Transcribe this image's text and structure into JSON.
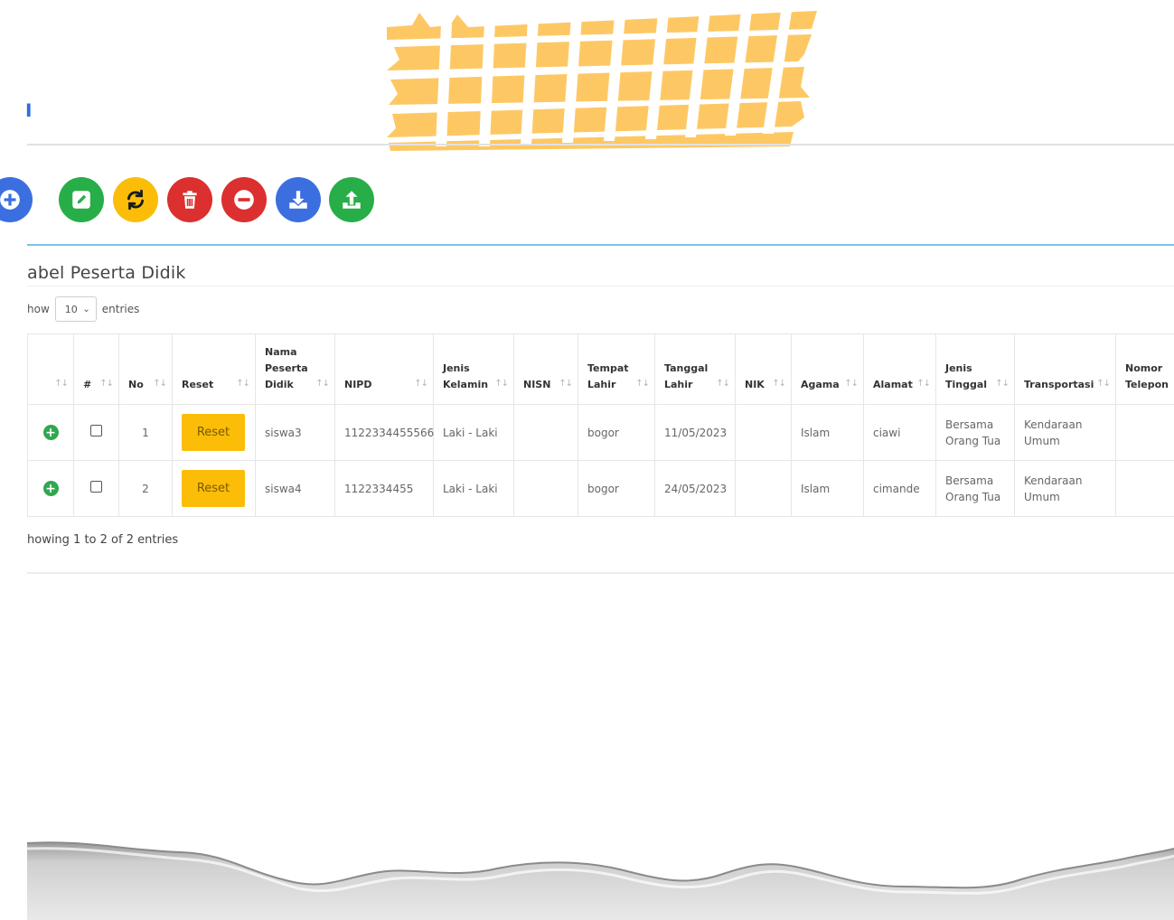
{
  "colors": {
    "tape": "#fdc864",
    "blue": "#3b82f6",
    "green": "#27ae48",
    "yellow": "#fbbd08",
    "red": "#dc2f2f",
    "reset_button": "#fbbd08",
    "divider_blue": "#7cc4e6"
  },
  "brand_glyph": "ⵏ",
  "toolbar": {
    "buttons": [
      {
        "name": "add-button",
        "icon": "plus-circle-icon",
        "color": "#3b6fe0"
      },
      {
        "name": "edit-button",
        "icon": "edit-icon",
        "color": "#27ae48"
      },
      {
        "name": "refresh-button",
        "icon": "refresh-icon",
        "color": "#fbbd08"
      },
      {
        "name": "delete-button",
        "icon": "trash-icon",
        "color": "#dc2f2f"
      },
      {
        "name": "remove-button",
        "icon": "minus-circle-icon",
        "color": "#dc2f2f"
      },
      {
        "name": "download-button",
        "icon": "download-icon",
        "color": "#3b6fe0"
      },
      {
        "name": "upload-button",
        "icon": "upload-icon",
        "color": "#27ae48"
      }
    ]
  },
  "table": {
    "title": "abel Peserta Didik",
    "length_label_before": "how",
    "length_value": "10",
    "length_label_after": "entries",
    "info": "howing 1 to 2 of 2 entries",
    "columns": [
      {
        "label": "",
        "sort": "↑↓"
      },
      {
        "label": "#",
        "sort": "↑↓"
      },
      {
        "label": "No",
        "sort": "↑↓"
      },
      {
        "label": "Reset",
        "sort": "↑↓"
      },
      {
        "label": "Nama Peserta Didik",
        "sort": "↑↓"
      },
      {
        "label": "NIPD",
        "sort": "↑↓"
      },
      {
        "label": "Jenis Kelamin",
        "sort": "↑↓"
      },
      {
        "label": "NISN",
        "sort": "↑↓"
      },
      {
        "label": "Tempat Lahir",
        "sort": "↑↓"
      },
      {
        "label": "Tanggal Lahir",
        "sort": "↑↓"
      },
      {
        "label": "NIK",
        "sort": "↑↓"
      },
      {
        "label": "Agama",
        "sort": "↑↓"
      },
      {
        "label": "Alamat",
        "sort": "↑↓"
      },
      {
        "label": "Jenis Tinggal",
        "sort": "↑↓"
      },
      {
        "label": "Transportasi",
        "sort": "↑↓"
      },
      {
        "label": "Nomor Telepon",
        "sort": ""
      }
    ],
    "rows": [
      {
        "expand": "+",
        "no": "1",
        "reset": "Reset",
        "nama": "siswa3",
        "nipd": "1122334455566",
        "jk": "Laki - Laki",
        "nisn": "",
        "tempat": "bogor",
        "tanggal": "11/05/2023",
        "nik": "",
        "agama": "Islam",
        "alamat": "ciawi",
        "tinggal": "Bersama Orang Tua",
        "transport": "Kendaraan Umum",
        "telepon": ""
      },
      {
        "expand": "+",
        "no": "2",
        "reset": "Reset",
        "nama": "siswa4",
        "nipd": "1122334455",
        "jk": "Laki - Laki",
        "nisn": "",
        "tempat": "bogor",
        "tanggal": "24/05/2023",
        "nik": "",
        "agama": "Islam",
        "alamat": "cimande",
        "tinggal": "Bersama Orang Tua",
        "transport": "Kendaraan Umum",
        "telepon": ""
      }
    ]
  }
}
